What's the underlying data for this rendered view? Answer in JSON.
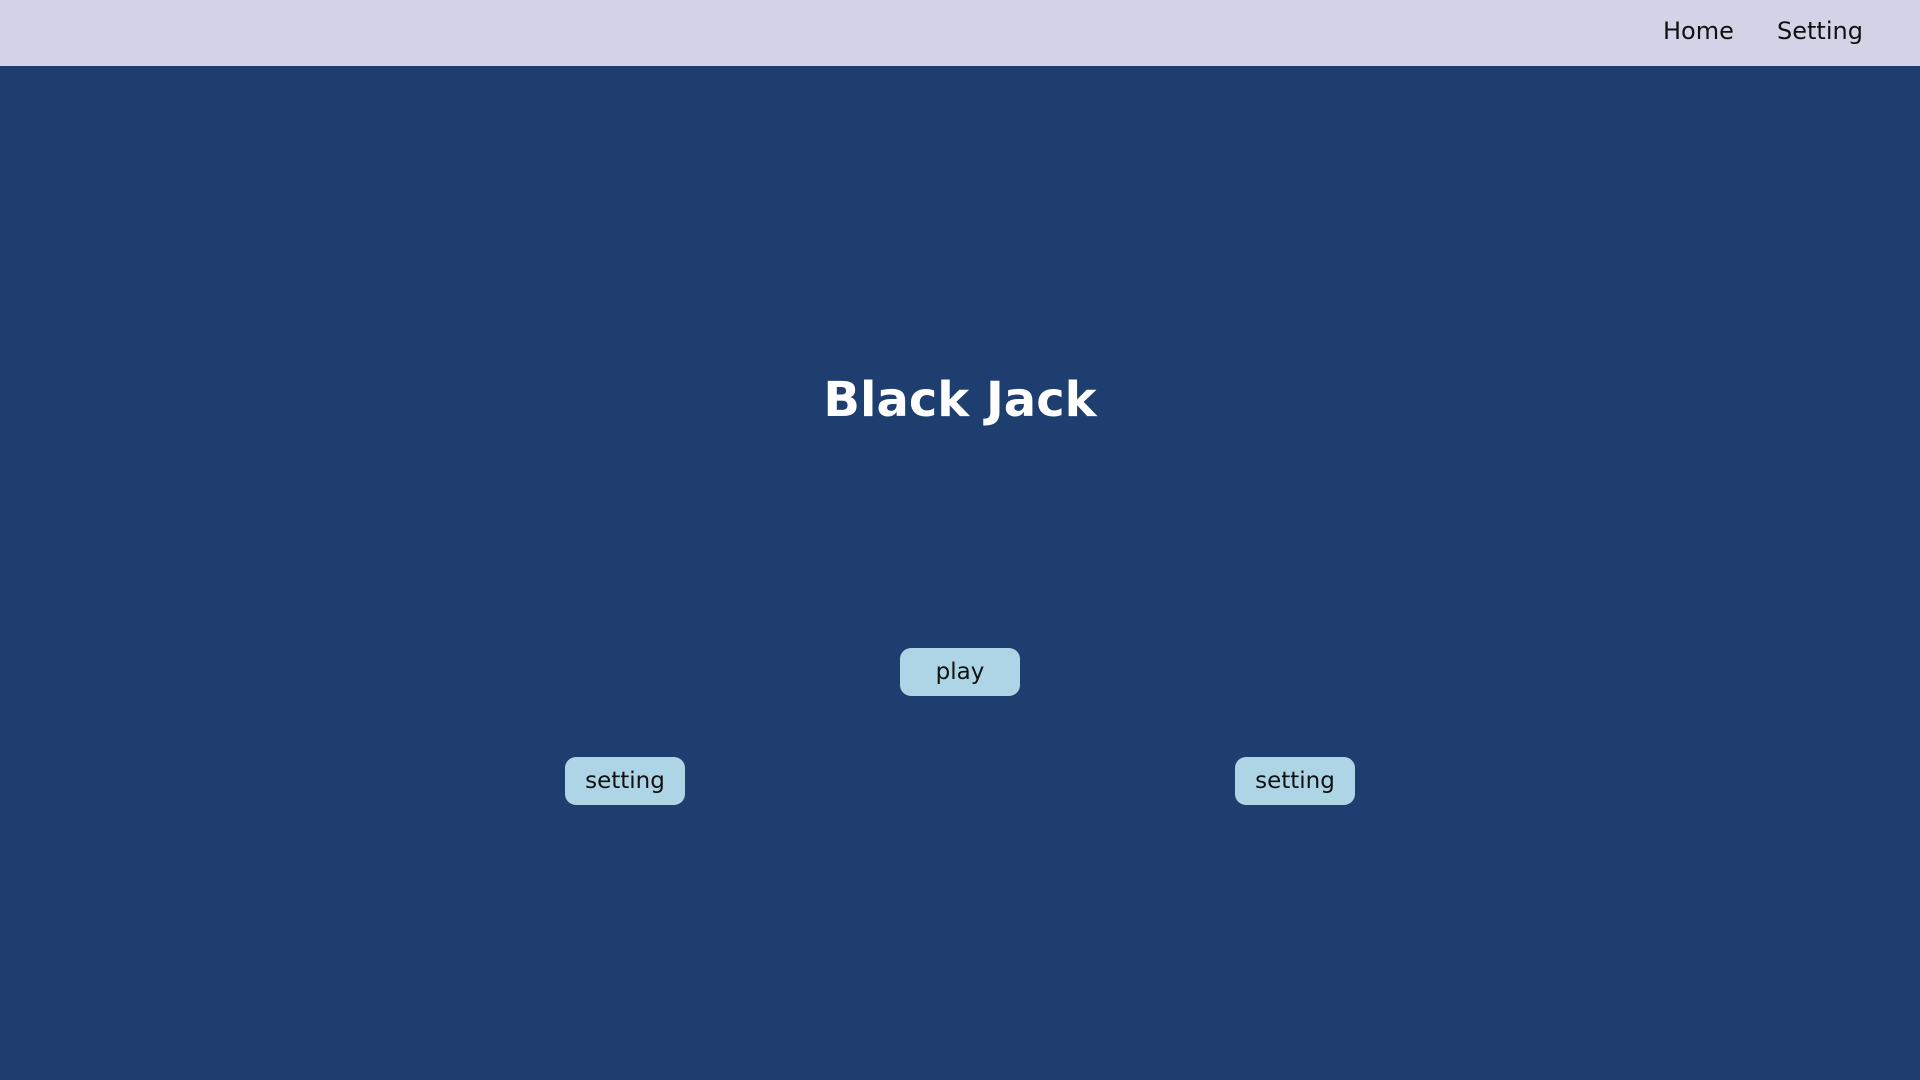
{
  "nav": {
    "home_label": "Home",
    "setting_label": "Setting"
  },
  "main": {
    "title": "Black Jack",
    "play_label": "play",
    "setting_left_label": "setting",
    "setting_right_label": "setting"
  },
  "colors": {
    "background": "#1d3e6e",
    "topbar": "#d2d3e6",
    "button": "#add5e6",
    "title_text": "#ffffff"
  }
}
